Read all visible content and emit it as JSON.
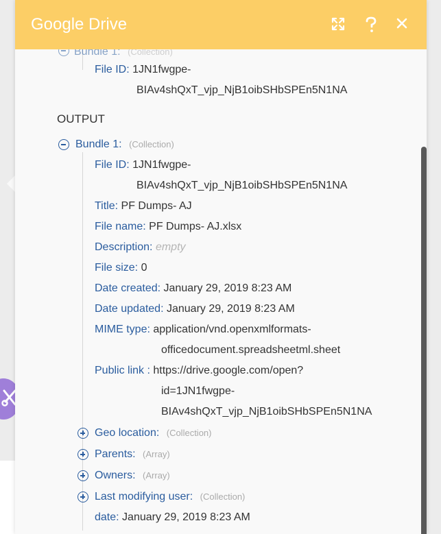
{
  "header": {
    "title": "Google Drive",
    "expand_icon": "expand-icon",
    "help_icon": "help-icon",
    "close_icon": "close-icon"
  },
  "input": {
    "bundle_label": "Bundle 1:",
    "bundle_type": "(Collection)",
    "file_id_key": "File ID:",
    "file_id_value_line1": "1JN1fwgpe-",
    "file_id_value_line2": "BIAv4shQxT_vjp_NjB1oibSHbSPEn5N1NA"
  },
  "output": {
    "heading": "OUTPUT",
    "bundle_label": "Bundle 1:",
    "bundle_type": "(Collection)",
    "fields": {
      "file_id_key": "File ID:",
      "file_id_line1": "1JN1fwgpe-",
      "file_id_line2": "BIAv4shQxT_vjp_NjB1oibSHbSPEn5N1NA",
      "title_key": "Title:",
      "title_value": "PF Dumps- AJ",
      "file_name_key": "File name:",
      "file_name_value": "PF Dumps- AJ.xlsx",
      "description_key": "Description:",
      "description_value": "empty",
      "file_size_key": "File size:",
      "file_size_value": "0",
      "date_created_key": "Date created:",
      "date_created_value": "January 29, 2019 8:23 AM",
      "date_updated_key": "Date updated:",
      "date_updated_value": "January 29, 2019 8:23 AM",
      "mime_key": "MIME type:",
      "mime_line1": "application/vnd.openxmlformats-",
      "mime_line2": "officedocument.spreadsheetml.sheet",
      "public_link_key": "Public link :",
      "public_link_line1": "https://drive.google.com/open?",
      "public_link_line2": "id=1JN1fwgpe-",
      "public_link_line3": "BIAv4shQxT_vjp_NjB1oibSHbSPEn5N1NA"
    },
    "collapsed": {
      "geo_key": "Geo location:",
      "geo_type": "(Collection)",
      "parents_key": "Parents:",
      "parents_type": "(Array)",
      "owners_key": "Owners:",
      "owners_type": "(Array)",
      "last_user_key": "Last modifying user:",
      "last_user_type": "(Collection)"
    },
    "date_key": "date:",
    "date_value": "January 29, 2019 8:23 AM"
  },
  "colors": {
    "header_bg": "#fcce66",
    "key_text": "#2a5c9e",
    "tool_circle": "#9f7fd9"
  },
  "side_tool_icon": "wrench-screwdriver-icon"
}
